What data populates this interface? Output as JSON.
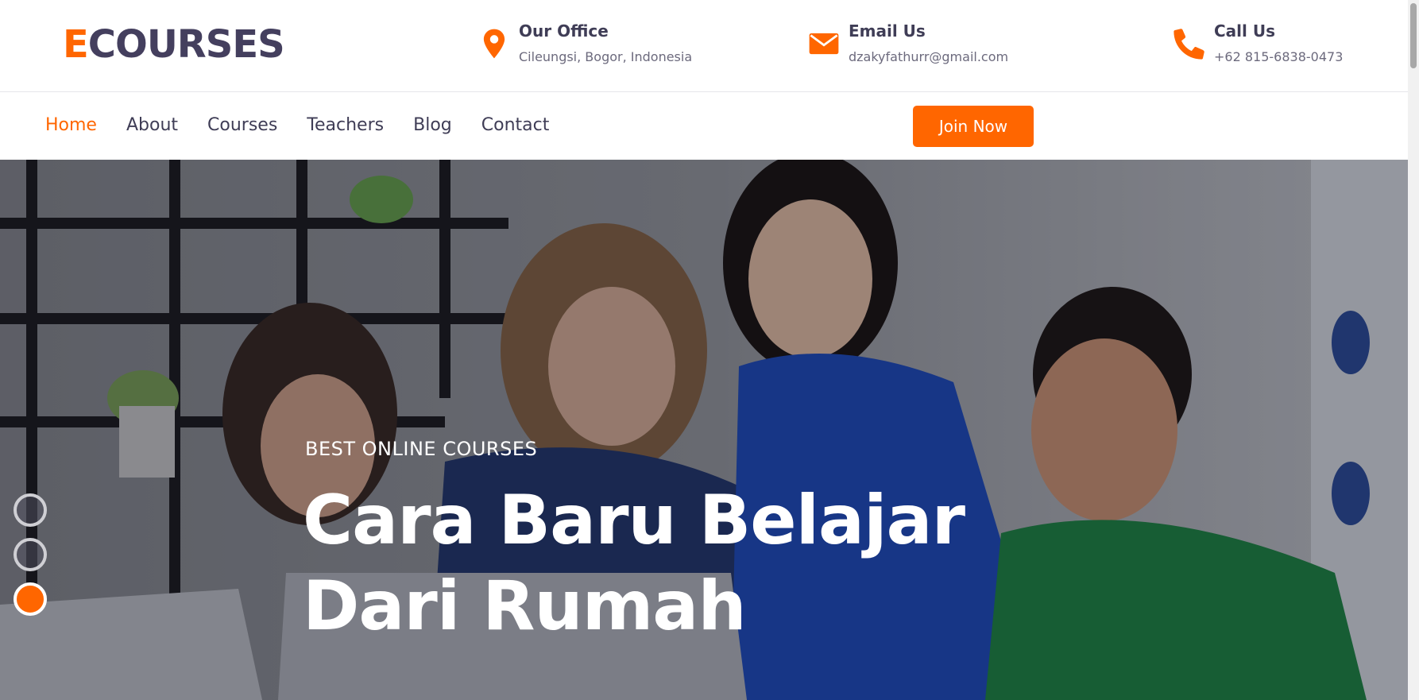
{
  "logo": {
    "first_letter": "E",
    "rest": "COURSES"
  },
  "contact": {
    "office": {
      "title": "Our Office",
      "value": "Cileungsi, Bogor, Indonesia",
      "icon": "map-marker-icon"
    },
    "email": {
      "title": "Email Us",
      "value": "dzakyfathurr@gmail.com",
      "icon": "envelope-icon"
    },
    "call": {
      "title": "Call Us",
      "value": "+62 815-6838-0473",
      "icon": "phone-icon"
    }
  },
  "nav": {
    "items": [
      {
        "label": "Home",
        "active": true
      },
      {
        "label": "About",
        "active": false
      },
      {
        "label": "Courses",
        "active": false
      },
      {
        "label": "Teachers",
        "active": false
      },
      {
        "label": "Blog",
        "active": false
      },
      {
        "label": "Contact",
        "active": false
      }
    ],
    "cta": "Join Now"
  },
  "hero": {
    "eyebrow": "BEST ONLINE COURSES",
    "headline_line1": "Cara Baru Belajar",
    "headline_line2": "Dari Rumah",
    "slides": {
      "count": 3,
      "active": 3
    }
  },
  "colors": {
    "accent": "#ff6600",
    "text_dark": "#3f3d56",
    "text_muted": "#6c6a7d"
  }
}
